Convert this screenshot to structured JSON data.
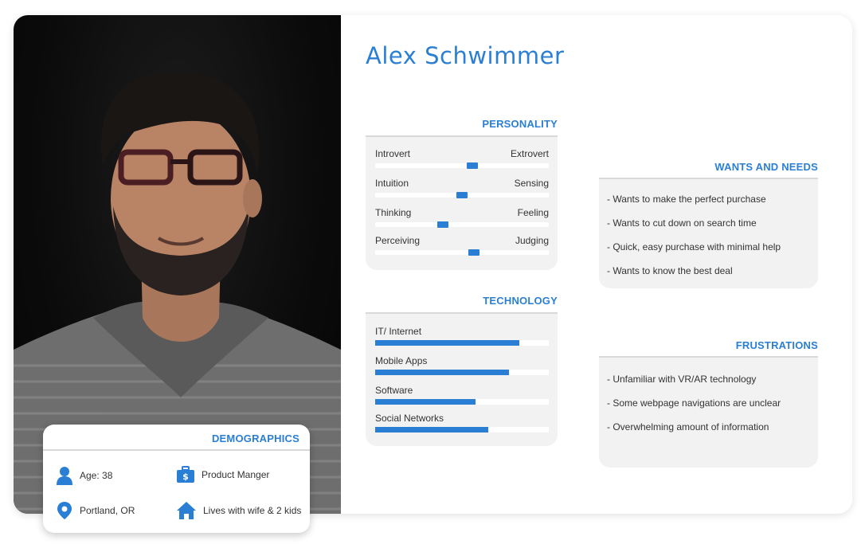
{
  "persona": {
    "name": "Alex Schwimmer"
  },
  "colors": {
    "accent": "#2a7fd4",
    "panel": "#f2f2f2"
  },
  "photo": {
    "icon": "portrait-photo"
  },
  "personality": {
    "title": "PERSONALITY",
    "traits": [
      {
        "left": "Introvert",
        "right": "Extrovert",
        "value": 0.56
      },
      {
        "left": "Intuition",
        "right": "Sensing",
        "value": 0.5
      },
      {
        "left": "Thinking",
        "right": "Feeling",
        "value": 0.39
      },
      {
        "left": "Perceiving",
        "right": "Judging",
        "value": 0.57
      }
    ]
  },
  "technology": {
    "title": "TECHNOLOGY",
    "items": [
      {
        "label": "IT/ Internet",
        "value": 0.83
      },
      {
        "label": "Mobile Apps",
        "value": 0.77
      },
      {
        "label": "Software",
        "value": 0.58
      },
      {
        "label": "Social Networks",
        "value": 0.65
      }
    ]
  },
  "wants": {
    "title": "WANTS AND NEEDS",
    "items": [
      "- Wants to make the perfect purchase",
      "- Wants to cut down on search time",
      "- Quick, easy purchase with minimal help",
      "- Wants to know the best deal"
    ]
  },
  "frustrations": {
    "title": "FRUSTRATIONS",
    "items": [
      "- Unfamiliar with VR/AR technology",
      "- Some webpage navigations are unclear",
      "- Overwhelming amount of information"
    ]
  },
  "demographics": {
    "title": "DEMOGRAPHICS",
    "age": "Age: 38",
    "job": "Product Manger",
    "location": "Portland, OR",
    "family": "Lives with wife & 2 kids",
    "icons": {
      "age": "person-icon",
      "job": "briefcase-dollar-icon",
      "location": "map-pin-icon",
      "family": "house-icon"
    }
  }
}
